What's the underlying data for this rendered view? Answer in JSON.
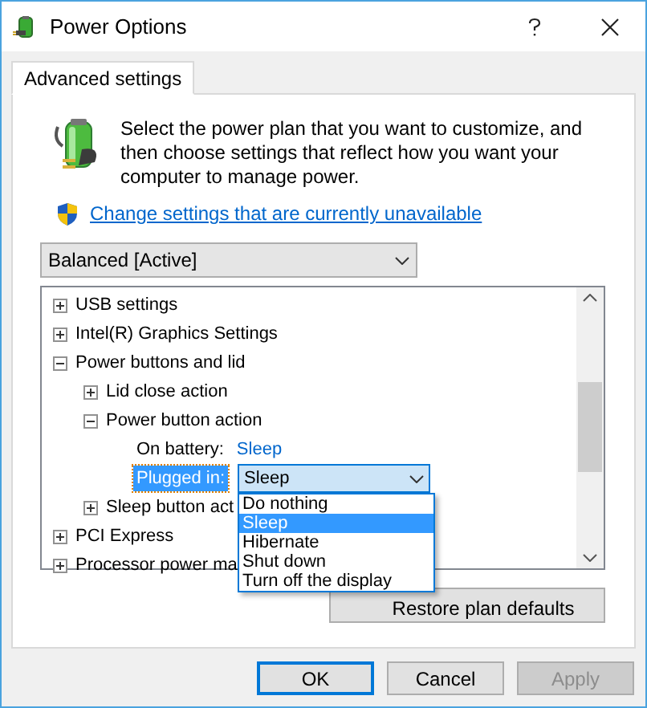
{
  "window": {
    "title": "Power Options"
  },
  "tabs": [
    {
      "label": "Advanced settings",
      "selected": true
    }
  ],
  "description": "Select the power plan that you want to customize, and then choose settings that reflect how you want your computer to manage power.",
  "link": "Change settings that are currently unavailable",
  "plan_select": {
    "value": "Balanced [Active]"
  },
  "tree": [
    {
      "kind": "group",
      "label": "USB settings",
      "expanded": false
    },
    {
      "kind": "group",
      "label": "Intel(R) Graphics Settings",
      "expanded": false
    },
    {
      "kind": "group",
      "label": "Power buttons and lid",
      "expanded": true,
      "children": [
        {
          "kind": "group",
          "label": "Lid close action",
          "expanded": false
        },
        {
          "kind": "group",
          "label": "Power button action",
          "expanded": true,
          "children": [
            {
              "kind": "setting",
              "label": "On battery:",
              "value": "Sleep",
              "selected": false
            },
            {
              "kind": "setting",
              "label": "Plugged in:",
              "value": "Sleep",
              "selected": true,
              "options": [
                {
                  "label": "Do nothing",
                  "selected": false
                },
                {
                  "label": "Sleep",
                  "selected": true
                },
                {
                  "label": "Hibernate",
                  "selected": false
                },
                {
                  "label": "Shut down",
                  "selected": false
                },
                {
                  "label": "Turn off the display",
                  "selected": false
                }
              ]
            }
          ]
        },
        {
          "kind": "group",
          "label": "Sleep button act",
          "expanded": false
        }
      ]
    },
    {
      "kind": "group",
      "label": "PCI Express",
      "expanded": false
    },
    {
      "kind": "group",
      "label": "Processor power ma",
      "expanded": false
    }
  ],
  "restore_button": "Restore plan defaults",
  "buttons": [
    {
      "label": "OK",
      "default": true,
      "disabled": false
    },
    {
      "label": "Cancel",
      "default": false,
      "disabled": false
    },
    {
      "label": "Apply",
      "default": false,
      "disabled": true
    }
  ]
}
